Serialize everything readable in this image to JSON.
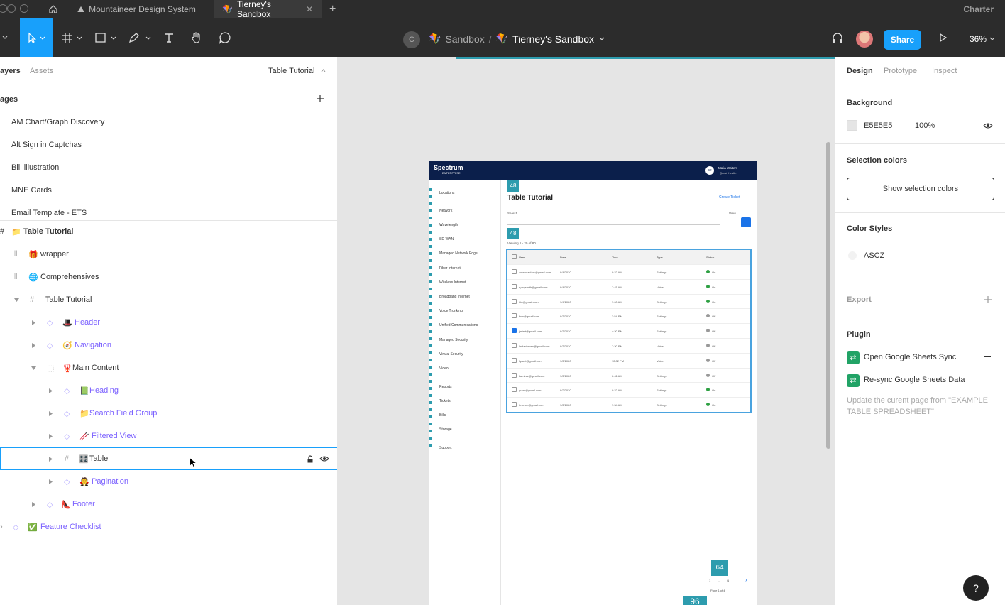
{
  "titlebar": {
    "tabs": [
      {
        "label": "Mountaineer Design System"
      },
      {
        "label": "Tierney's Sandbox"
      }
    ],
    "right_label": "Charter",
    "add_tab": "+"
  },
  "toolbar": {
    "avatar_letter": "C",
    "breadcrumb_project": "Sandbox",
    "breadcrumb_sep": "/",
    "breadcrumb_file": "Tierney's Sandbox",
    "share_label": "Share",
    "zoom": "36%"
  },
  "left": {
    "tab_layers": "ayers",
    "tab_assets": "Assets",
    "page_selector": "Table Tutorial",
    "pages_header": "ages",
    "pages": [
      "AM Chart/Graph Discovery",
      "Alt Sign in Captchas",
      "Bill illustration",
      "MNE Cards",
      "Email Template - ETS"
    ],
    "layers": [
      {
        "label": "Table Tutorial",
        "emoji": "📁"
      },
      {
        "label": "wrapper",
        "emoji": "🎁"
      },
      {
        "label": "Comprehensives",
        "emoji": "🌐"
      },
      {
        "label": "Table Tutorial",
        "emoji": ""
      },
      {
        "label": "Header",
        "emoji": "🎩"
      },
      {
        "label": "Navigation",
        "emoji": "🧭"
      },
      {
        "label": "Main Content",
        "emoji": "🦞"
      },
      {
        "label": "Heading",
        "emoji": "📗"
      },
      {
        "label": "Search Field Group",
        "emoji": "📁"
      },
      {
        "label": "Filtered View",
        "emoji": "🥢"
      },
      {
        "label": "Table",
        "emoji": "🎛️"
      },
      {
        "label": "Pagination",
        "emoji": "🧛"
      },
      {
        "label": "Footer",
        "emoji": "👠"
      },
      {
        "label": "Feature Checklist",
        "emoji": "✅"
      }
    ]
  },
  "right": {
    "tabs": [
      "Design",
      "Prototype",
      "Inspect"
    ],
    "background_label": "Background",
    "background_hex": "E5E5E5",
    "background_opacity": "100%",
    "selection_colors_label": "Selection colors",
    "show_selection_button": "Show selection colors",
    "color_styles_label": "Color Styles",
    "color_style_name": "ASCZ",
    "export_label": "Export",
    "plugin_label": "Plugin",
    "plugin_1": "Open Google Sheets Sync",
    "plugin_2": "Re-sync Google Sheets Data",
    "plugin_desc": "Update the curent page from \"EXAMPLE TABLE SPREADSHEET\"",
    "help": "?"
  },
  "canvas": {
    "brand": "Spectrum",
    "brand_sub": "ENTERPRISE",
    "user_name": "Malia Walters",
    "user_sub": "Quest Health",
    "user_initials": "se",
    "page_title": "Table Tutorial",
    "create_ticket": "Create Ticket",
    "search_label": "Search",
    "view_label": "View",
    "viewing": "Viewing 1 - 20 of 80",
    "nav": [
      "Locations",
      "Network",
      "Wavelength",
      "SD-WAN",
      "Managed Network Edge",
      "Fiber Internet",
      "Wireless Internet",
      "Broadband Internet",
      "Voice Trunking",
      "Unified Communications",
      "Managed Security",
      "Virtual Security",
      "Video",
      "Reports",
      "Tickets",
      "Bills",
      "Storage",
      "Support"
    ],
    "columns": [
      "User",
      "Date",
      "Time",
      "Type",
      "Status"
    ],
    "rows": [
      {
        "user": "amandaclark@gmail.com",
        "date": "9/4/2020",
        "time": "9:22 AM",
        "type": "Settings",
        "status": "On"
      },
      {
        "user": "ryanjsmith@gmail.com",
        "date": "9/4/2020",
        "time": "7:45 AM",
        "type": "Voice",
        "status": "On"
      },
      {
        "user": "tito@gmail.com",
        "date": "9/4/2020",
        "time": "7:00 AM",
        "type": "Settings",
        "status": "On"
      },
      {
        "user": "brm@gmail.com",
        "date": "9/3/2020",
        "time": "3:54 PM",
        "type": "Settings",
        "status": "Off"
      },
      {
        "user": "jmfert@gmail.com",
        "date": "9/3/2020",
        "time": "4:20 PM",
        "type": "Settings",
        "status": "Off"
      },
      {
        "user": "lindachaves@gmail.com",
        "date": "9/3/2020",
        "time": "7:30 PM",
        "type": "Voice",
        "status": "Off"
      },
      {
        "user": "lipsett@gmail.com",
        "date": "9/2/2020",
        "time": "12:02 PM",
        "type": "Voice",
        "status": "Off"
      },
      {
        "user": "kamirez@gmail.com",
        "date": "9/2/2020",
        "time": "6:42 AM",
        "type": "Settings",
        "status": "Off"
      },
      {
        "user": "grant@gmail.com",
        "date": "9/2/2020",
        "time": "8:22 AM",
        "type": "Settings",
        "status": "On"
      },
      {
        "user": "tmcrum@gmail.com",
        "date": "9/2/2020",
        "time": "7:34 AM",
        "type": "Settings",
        "status": "On"
      }
    ],
    "badge_1": "48",
    "badge_2": "48",
    "badge_3": "64",
    "badge_4": "96",
    "page_indicator": "Page 1 of 4",
    "page_ellipsis": "...",
    "page_num_1": "1",
    "page_num_last": "4"
  },
  "colors": {
    "accent": "#18a0fb",
    "frame_header": "#0b1f4b",
    "status_on": "#2ea043",
    "status_off": "#999999",
    "teal": "#2d9cae"
  }
}
